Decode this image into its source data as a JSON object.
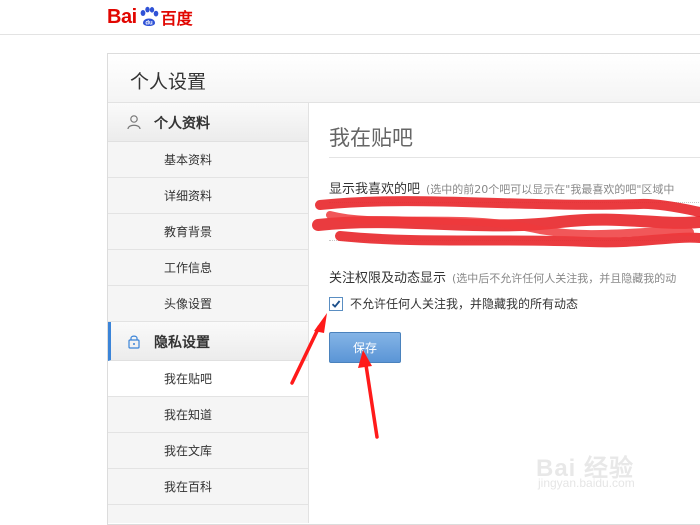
{
  "brand": {
    "logo_latin": "Bai",
    "logo_cn": "百度",
    "color": "#e10601"
  },
  "panel": {
    "title": "个人设置"
  },
  "sidebar": {
    "sections": [
      {
        "icon": "user-icon",
        "label": "个人资料",
        "items": [
          "基本资料",
          "详细资料",
          "教育背景",
          "工作信息",
          "头像设置"
        ]
      },
      {
        "icon": "lock-icon",
        "label": "隐私设置",
        "items": [
          "我在贴吧",
          "我在知道",
          "我在文库",
          "我在百科"
        ]
      }
    ],
    "current_item": "我在贴吧",
    "accent_color": "#3b84d8"
  },
  "main": {
    "title": "我在贴吧",
    "favorite_bars": {
      "label": "显示我喜欢的吧",
      "note": "(选中的前20个吧可以显示在\"我最喜欢的吧\"区域中"
    },
    "follow": {
      "label": "关注权限及动态显示",
      "note": "(选中后不允许任何人关注我，并且隐藏我的动"
    },
    "checkbox": {
      "label": "不允许任何人关注我，并隐藏我的所有动态",
      "checked": true
    },
    "save_label": "保存"
  },
  "watermark": {
    "text": "Bai 经验",
    "url": "jingyan.baidu.com"
  }
}
